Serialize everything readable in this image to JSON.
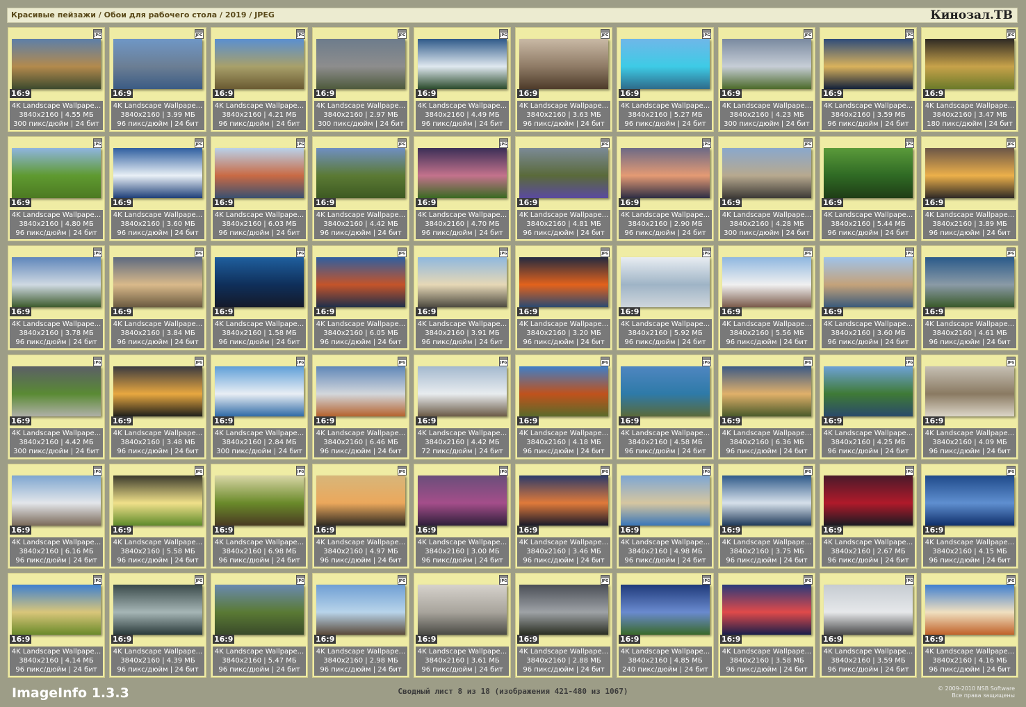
{
  "header": {
    "path": "Красивые пейзажи / Обои для рабочего стола / 2019 / JPEG",
    "logo": "Кинозал.ТВ"
  },
  "tile_common": {
    "icon": "jpg-file-icon",
    "icon_label": "JPG",
    "aspect": "16:9",
    "name": "4K Landscape Wallpape...",
    "resolution": "3840x2160",
    "depth": "24 бит"
  },
  "tiles": [
    {
      "size": "4.55 МБ",
      "dpi": "300",
      "colors": [
        "#5d7fa8",
        "#b38a4d",
        "#3d4a2e"
      ]
    },
    {
      "size": "3.99 МБ",
      "dpi": "96",
      "colors": [
        "#6f97c6",
        "#6b7e94",
        "#3b5b84"
      ]
    },
    {
      "size": "4.21 МБ",
      "dpi": "96",
      "colors": [
        "#5a8fd0",
        "#a8a06a",
        "#6a5a32"
      ]
    },
    {
      "size": "2.97 МБ",
      "dpi": "300",
      "colors": [
        "#6d7c8c",
        "#8d8d8d",
        "#4e5a3c"
      ]
    },
    {
      "size": "4.49 МБ",
      "dpi": "96",
      "colors": [
        "#2f5a8a",
        "#dfe8ef",
        "#2b4b2c"
      ]
    },
    {
      "size": "3.63 МБ",
      "dpi": "96",
      "colors": [
        "#c9b9a5",
        "#8f7b66",
        "#4e3b2a"
      ]
    },
    {
      "size": "5.27 МБ",
      "dpi": "96",
      "colors": [
        "#6fb7e8",
        "#3ecbe6",
        "#2e6b8a"
      ]
    },
    {
      "size": "4.23 МБ",
      "dpi": "300",
      "colors": [
        "#7a8aa0",
        "#c6cdd6",
        "#4c6a2a"
      ]
    },
    {
      "size": "3.59 МБ",
      "dpi": "96",
      "colors": [
        "#2e4c7a",
        "#d9b25c",
        "#13213a"
      ]
    },
    {
      "size": "3.47 МБ",
      "dpi": "180",
      "colors": [
        "#2f2b24",
        "#c7a24a",
        "#6b7a2a"
      ]
    },
    {
      "size": "4.80 МБ",
      "dpi": "96",
      "colors": [
        "#8fb5e0",
        "#5f9a30",
        "#4c7a22"
      ]
    },
    {
      "size": "3.60 МБ",
      "dpi": "96",
      "colors": [
        "#2f5fa0",
        "#e9f0f6",
        "#1e3f78"
      ]
    },
    {
      "size": "6.03 МБ",
      "dpi": "96",
      "colors": [
        "#b9d1ea",
        "#c96a44",
        "#3a5070"
      ]
    },
    {
      "size": "4.42 МБ",
      "dpi": "96",
      "colors": [
        "#6f8fc2",
        "#5b7a34",
        "#3d5a22"
      ]
    },
    {
      "size": "4.70 МБ",
      "dpi": "96",
      "colors": [
        "#3b2f57",
        "#c3728c",
        "#3a6a22"
      ]
    },
    {
      "size": "4.81 МБ",
      "dpi": "96",
      "colors": [
        "#7b8a96",
        "#5a6a3a",
        "#5a4aa0"
      ]
    },
    {
      "size": "2.90 МБ",
      "dpi": "96",
      "colors": [
        "#6d6a86",
        "#e49a74",
        "#2e2e44"
      ]
    },
    {
      "size": "4.28 МБ",
      "dpi": "300",
      "colors": [
        "#8aa8cc",
        "#b7a98f",
        "#3d3a36"
      ]
    },
    {
      "size": "5.44 МБ",
      "dpi": "96",
      "colors": [
        "#5a9a3a",
        "#2f6a24",
        "#1f3d16"
      ]
    },
    {
      "size": "3.89 МБ",
      "dpi": "96",
      "colors": [
        "#6b5648",
        "#ecb04a",
        "#2f2a26"
      ]
    },
    {
      "size": "3.78 МБ",
      "dpi": "96",
      "colors": [
        "#5f86bb",
        "#cfd9e2",
        "#3c5a2c"
      ]
    },
    {
      "size": "3.84 МБ",
      "dpi": "96",
      "colors": [
        "#5d6a80",
        "#d9b98a",
        "#6a5a40"
      ]
    },
    {
      "size": "1.58 МБ",
      "dpi": "96",
      "colors": [
        "#1f5f9e",
        "#0f2f5a",
        "#141a2a"
      ]
    },
    {
      "size": "6.05 МБ",
      "dpi": "96",
      "colors": [
        "#2f5fa0",
        "#c4542a",
        "#1f2f4a"
      ]
    },
    {
      "size": "3.91 МБ",
      "dpi": "96",
      "colors": [
        "#8fb8df",
        "#e6d8b6",
        "#4d4a40"
      ]
    },
    {
      "size": "3.20 МБ",
      "dpi": "96",
      "colors": [
        "#232a40",
        "#e2621c",
        "#2a4a72"
      ]
    },
    {
      "size": "5.92 МБ",
      "dpi": "96",
      "colors": [
        "#e8edf2",
        "#9fb4c6",
        "#cfd6dc"
      ]
    },
    {
      "size": "5.56 МБ",
      "dpi": "96",
      "colors": [
        "#8fb7e0",
        "#f0f0f0",
        "#7a5a4a"
      ]
    },
    {
      "size": "3.60 МБ",
      "dpi": "96",
      "colors": [
        "#9fc3ea",
        "#c4a27a",
        "#3a5a7a"
      ]
    },
    {
      "size": "4.61 МБ",
      "dpi": "96",
      "colors": [
        "#2a5a8a",
        "#8a9aa6",
        "#3a5a2a"
      ]
    },
    {
      "size": "4.42 МБ",
      "dpi": "300",
      "colors": [
        "#5b5f66",
        "#5a8a34",
        "#b0b0a8"
      ]
    },
    {
      "size": "3.48 МБ",
      "dpi": "96",
      "colors": [
        "#3a3a40",
        "#e8a840",
        "#1f1f1a"
      ]
    },
    {
      "size": "2.84 МБ",
      "dpi": "300",
      "colors": [
        "#5f9fd8",
        "#e9eef4",
        "#2f6aa6"
      ]
    },
    {
      "size": "6.46 МБ",
      "dpi": "96",
      "colors": [
        "#5f87b8",
        "#d3d7dc",
        "#b5622e"
      ]
    },
    {
      "size": "4.42 МБ",
      "dpi": "72",
      "colors": [
        "#a4b9cf",
        "#e8ecef",
        "#6a5a46"
      ]
    },
    {
      "size": "4.18 МБ",
      "dpi": "96",
      "colors": [
        "#3f7fc8",
        "#c0521c",
        "#5a6a2a"
      ]
    },
    {
      "size": "4.58 МБ",
      "dpi": "96",
      "colors": [
        "#4f86c0",
        "#2e7aa8",
        "#5a6a3a"
      ]
    },
    {
      "size": "6.36 МБ",
      "dpi": "96",
      "colors": [
        "#3c5a86",
        "#e0b06a",
        "#4a5a2a"
      ]
    },
    {
      "size": "4.25 МБ",
      "dpi": "96",
      "colors": [
        "#6ea2d6",
        "#3f7a36",
        "#2a4a6a"
      ]
    },
    {
      "size": "4.09 МБ",
      "dpi": "96",
      "colors": [
        "#c6c0b4",
        "#8a7a62",
        "#dcd6c8"
      ]
    },
    {
      "size": "6.16 МБ",
      "dpi": "96",
      "colors": [
        "#7ea6d0",
        "#e3e6ea",
        "#7a6a5a"
      ]
    },
    {
      "size": "5.58 МБ",
      "dpi": "96",
      "colors": [
        "#3a3a2c",
        "#f0e08a",
        "#5f8a2a"
      ]
    },
    {
      "size": "6.98 МБ",
      "dpi": "96",
      "colors": [
        "#d9d6a6",
        "#6a8a2a",
        "#4a3a22"
      ]
    },
    {
      "size": "4.97 МБ",
      "dpi": "96",
      "colors": [
        "#d7b67a",
        "#eba85c",
        "#2f2a22"
      ]
    },
    {
      "size": "3.00 МБ",
      "dpi": "96",
      "colors": [
        "#6a4e7a",
        "#a44e8a",
        "#2f1f3a"
      ]
    },
    {
      "size": "3.46 МБ",
      "dpi": "96",
      "colors": [
        "#2a3a6a",
        "#e07a3a",
        "#1a1a2a"
      ]
    },
    {
      "size": "4.98 МБ",
      "dpi": "96",
      "colors": [
        "#7da6d4",
        "#d6c6a0",
        "#3a76b8"
      ]
    },
    {
      "size": "3.75 МБ",
      "dpi": "96",
      "colors": [
        "#2f5a8a",
        "#d6e0ea",
        "#1f3a5a"
      ]
    },
    {
      "size": "2.67 МБ",
      "dpi": "96",
      "colors": [
        "#4a1a2a",
        "#b01a2a",
        "#1a1a22"
      ]
    },
    {
      "size": "4.15 МБ",
      "dpi": "96",
      "colors": [
        "#1f4a8a",
        "#5f8fd0",
        "#0f2f6a"
      ]
    },
    {
      "size": "4.14 МБ",
      "dpi": "96",
      "colors": [
        "#3e80cf",
        "#d9c67a",
        "#6a8a2a"
      ]
    },
    {
      "size": "4.39 МБ",
      "dpi": "96",
      "colors": [
        "#3a4a4a",
        "#a6b6b6",
        "#2a3a3a"
      ]
    },
    {
      "size": "5.47 МБ",
      "dpi": "96",
      "colors": [
        "#6a8ab0",
        "#5a7a34",
        "#3a4a2a"
      ]
    },
    {
      "size": "2.98 МБ",
      "dpi": "96",
      "colors": [
        "#6f9fd4",
        "#b8d4ea",
        "#5a4a3a"
      ]
    },
    {
      "size": "3.61 МБ",
      "dpi": "96",
      "colors": [
        "#d6d2cc",
        "#a8a49c",
        "#4a4a44"
      ]
    },
    {
      "size": "2.88 МБ",
      "dpi": "96",
      "colors": [
        "#4a4e56",
        "#9ea2a6",
        "#2a2e22"
      ]
    },
    {
      "size": "4.85 МБ",
      "dpi": "240",
      "colors": [
        "#1f3a7a",
        "#6a8acf",
        "#3a6a2a"
      ]
    },
    {
      "size": "3.58 МБ",
      "dpi": "96",
      "colors": [
        "#2a3a7a",
        "#e04a4a",
        "#1a1f4a"
      ]
    },
    {
      "size": "3.59 МБ",
      "dpi": "96",
      "colors": [
        "#c6ccd2",
        "#e6e8ea",
        "#4a4a4a"
      ]
    },
    {
      "size": "4.16 МБ",
      "dpi": "96",
      "colors": [
        "#3f7fd0",
        "#f0e0c0",
        "#c0622a"
      ]
    }
  ],
  "footer": {
    "app": "ImageInfo 1.3.3",
    "summary": "Сводный лист 8 из 18 (изображения 421-480 из 1067)",
    "copyright": "© 2009-2010 NSB Software",
    "rights": "Все права защищены"
  }
}
